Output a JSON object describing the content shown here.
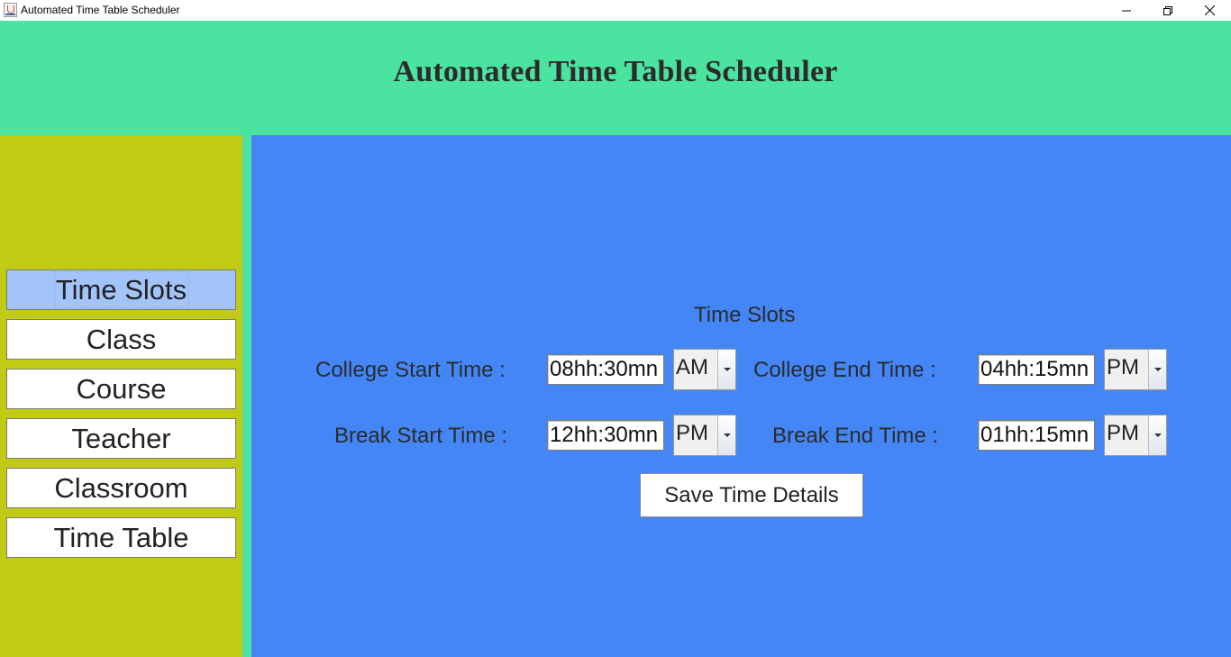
{
  "window": {
    "title": "Automated Time Table Scheduler",
    "controls": [
      "minimize",
      "maximize",
      "close"
    ]
  },
  "header": {
    "title": "Automated Time Table Scheduler"
  },
  "sidebar": {
    "items": [
      {
        "label": "Time Slots",
        "active": true
      },
      {
        "label": "Class",
        "active": false
      },
      {
        "label": "Course",
        "active": false
      },
      {
        "label": "Teacher",
        "active": false
      },
      {
        "label": "Classroom",
        "active": false
      },
      {
        "label": "Time Table",
        "active": false
      }
    ]
  },
  "main": {
    "section_title": "Time Slots",
    "college_start": {
      "label": "College Start Time :",
      "value": "08hh:30mn",
      "period": "AM"
    },
    "college_end": {
      "label": "College End Time :",
      "value": "04hh:15mn",
      "period": "PM"
    },
    "break_start": {
      "label": "Break Start Time :",
      "value": "12hh:30mn",
      "period": "PM"
    },
    "break_end": {
      "label": "Break End Time :",
      "value": "01hh:15mn",
      "period": "PM"
    },
    "save_button": "Save Time Details"
  },
  "colors": {
    "header_bg": "#4be3a0",
    "sidebar_bg": "#c1cb16",
    "main_bg": "#4486f6",
    "active_nav_bg": "#a3c4fb"
  }
}
